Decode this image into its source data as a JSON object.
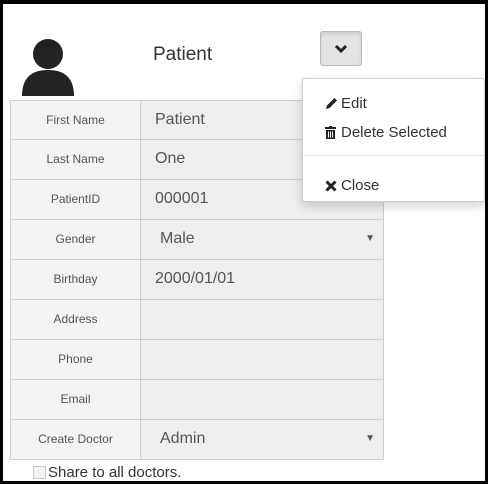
{
  "header": {
    "title": "Patient"
  },
  "form": {
    "rows": [
      {
        "label": "First Name",
        "value": "Patient"
      },
      {
        "label": "Last Name",
        "value": "One"
      },
      {
        "label": "PatientID",
        "value": "000001"
      },
      {
        "label": "Gender",
        "value": "Male"
      },
      {
        "label": "Birthday",
        "value": "2000/01/01"
      },
      {
        "label": "Address",
        "value": ""
      },
      {
        "label": "Phone",
        "value": ""
      },
      {
        "label": "Email",
        "value": ""
      },
      {
        "label": "Create Doctor",
        "value": "Admin"
      }
    ],
    "share_label": "Share to all doctors."
  },
  "menu": {
    "items": [
      {
        "label": "Edit",
        "icon": "pencil-icon"
      },
      {
        "label": "Delete Selected",
        "icon": "trash-icon"
      },
      {
        "label": "Close",
        "icon": "times-icon"
      }
    ]
  },
  "icons": {
    "avatar": "user-icon",
    "dropdown": "chevron-down-icon"
  }
}
